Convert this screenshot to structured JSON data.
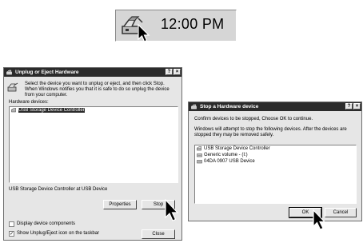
{
  "taskbar": {
    "clock": "12:00 PM"
  },
  "unplug_dialog": {
    "title": "Unplug or Eject Hardware",
    "help_btn": "?",
    "close_btn": "×",
    "instruction": "Select the device you want to unplug or eject, and then click Stop. When Windows notifies you that it is safe to do so unplug the device from your computer.",
    "hardware_label": "Hardware devices:",
    "devices": [
      "USB Storage Device Controller"
    ],
    "selected_device_status": "USB Storage Device Controller at USB Device",
    "properties_btn": "Properties",
    "stop_btn": "Stop",
    "display_components_label": "Display device components",
    "display_components_checked": false,
    "show_icon_label": "Show Unplug/Eject icon on the taskbar",
    "show_icon_checked": true,
    "close_label": "Close"
  },
  "stop_dialog": {
    "title": "Stop a Hardware device",
    "help_btn": "?",
    "close_btn": "×",
    "confirm_text": "Confirm devices to be stopped, Choose OK to continue.",
    "attempt_text": "Windows will attempt to stop the following devices. After the devices are stopped they may be removed safely.",
    "devices": [
      "USB Storage Device Controller",
      "Generic volume - (I:)",
      "04DA 0907 USB Device"
    ],
    "ok_btn": "OK",
    "cancel_btn": "Cancel"
  }
}
